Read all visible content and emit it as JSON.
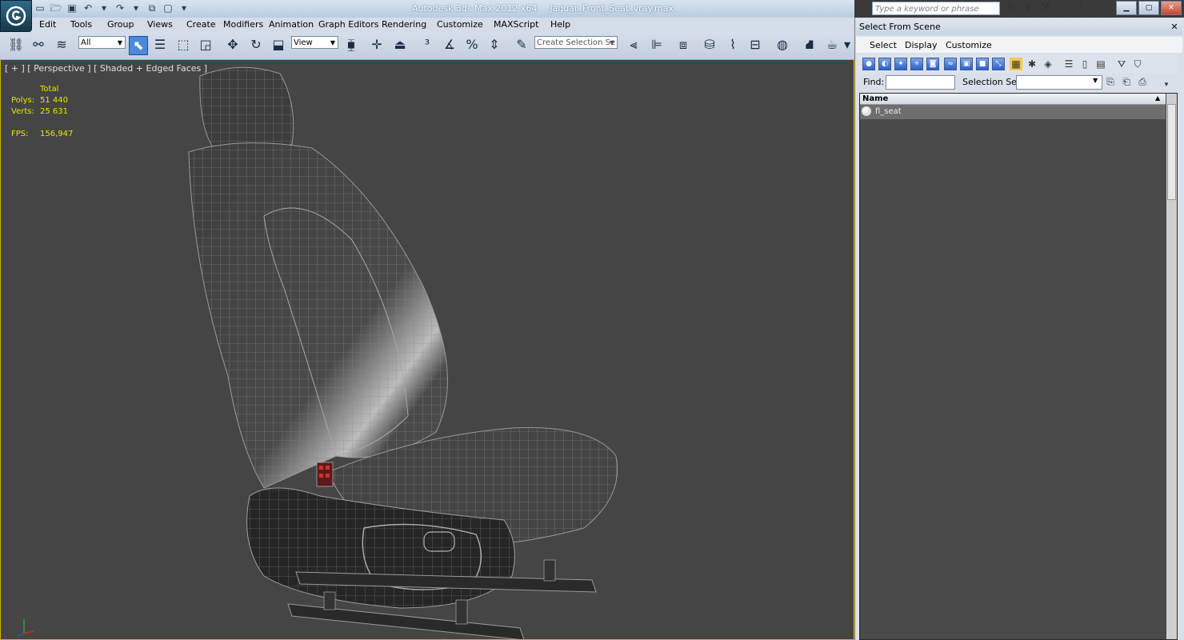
{
  "title": {
    "app": "Autodesk 3ds Max  2012 x64",
    "file": "Jaguar_Front_Seat_vray.max"
  },
  "menu": [
    "Edit",
    "Tools",
    "Group",
    "Views",
    "Create",
    "Modifiers",
    "Animation",
    "Graph Editors",
    "Rendering",
    "Customize",
    "MAXScript",
    "Help"
  ],
  "search": {
    "placeholder": "Type a keyword or phrase"
  },
  "toolbar": {
    "filter_value": "All",
    "coord_value": "View",
    "selection_set_placeholder": "Create Selection Se"
  },
  "viewport": {
    "label": "[ + ] [ Perspective ] [ Shaded + Edged Faces ]",
    "stats_header": "Total",
    "polys_label": "Polys:",
    "polys_value": "51 440",
    "verts_label": "Verts:",
    "verts_value": "25 631",
    "fps_label": "FPS:",
    "fps_value": "156,947",
    "colors": {
      "stats": "#e8e600",
      "border": "#d8b300"
    }
  },
  "panel": {
    "title": "Select From Scene",
    "menu": [
      "Select",
      "Display",
      "Customize"
    ],
    "find_label": "Find:",
    "selection_set_label": "Selection Set:",
    "column_name": "Name",
    "items": [
      {
        "label": "fl_seat"
      }
    ]
  }
}
